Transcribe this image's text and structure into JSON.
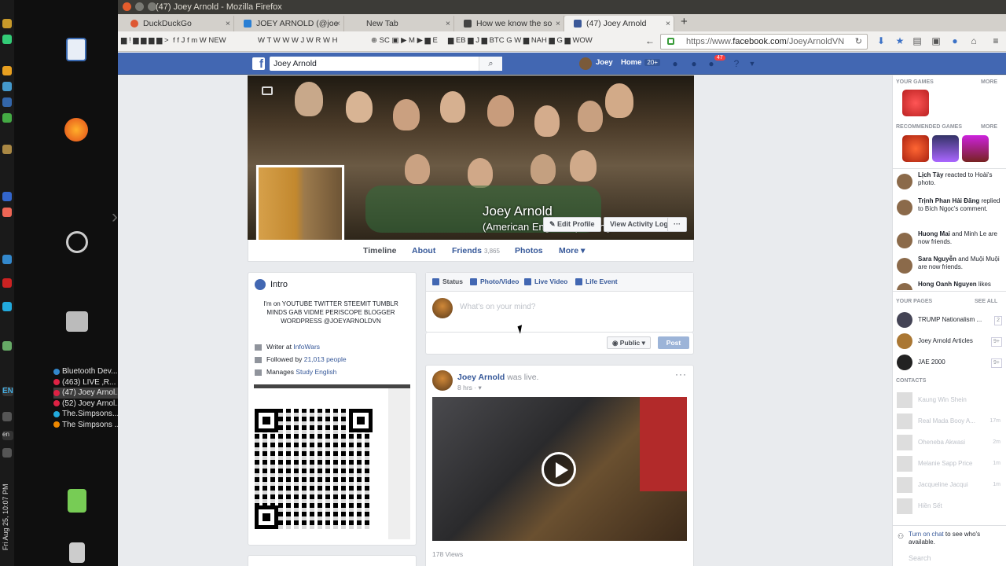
{
  "window": {
    "title": "(47) Joey Arnold - Mozilla Firefox"
  },
  "tabs": [
    {
      "label": "DuckDuckGo",
      "color": "#de5833"
    },
    {
      "label": "JOEY ARNOLD (@joe",
      "color": "#2a7fd4"
    },
    {
      "label": "New Tab",
      "color": "#dddddd"
    },
    {
      "label": "How we know the so",
      "color": "#444444"
    },
    {
      "label": "(47) Joey Arnold",
      "color": "#3b5998"
    }
  ],
  "bookmarks": [
    "!",
    "J",
    "m",
    "NEW",
    "T",
    "W",
    "J",
    "R",
    "H",
    "SC",
    "M",
    "E",
    "EB",
    "J",
    "BTC",
    "G",
    "NAH",
    "G",
    "WOW"
  ],
  "url": {
    "prefix": "https://www.",
    "domain": "facebook.com",
    "path": "/JoeyArnoldVN"
  },
  "taskbar": {
    "entries": [
      "Bluetooth Dev...",
      "(463) LIVE ‚R...",
      "(47) Joey Arnol...",
      "(52) Joey Arnol...",
      "The.Simpsons....",
      "The Simpsons ..."
    ],
    "clock": "Fri Aug 25, 10:07 PM",
    "lang": "EN",
    "lang2": "en"
  },
  "fb": {
    "search_value": "Joey Arnold",
    "user_name": "Joey",
    "home_label": "Home",
    "home_badge": "20+",
    "notif_count": "47"
  },
  "profile": {
    "name": "Joey Arnold",
    "subtitle": "(American English Speaking ...",
    "edit_profile": "Edit Profile",
    "view_activity": "View Activity Log",
    "more_dots": "···",
    "tabs": {
      "timeline": "Timeline",
      "about": "About",
      "friends": "Friends",
      "friends_count": "3,865",
      "photos": "Photos",
      "more": "More ▾"
    }
  },
  "intro": {
    "heading": "Intro",
    "bio": "I'm on YOUTUBE TWITTER STEEMIT TUMBLR MINDS GAB VIDME PERISCOPE BLOGGER WORDPRESS @JOEYARNOLDVN",
    "writer_prefix": "Writer at ",
    "writer_link": "InfoWars",
    "followed_prefix": "Followed by ",
    "followed_link": "21,013 people",
    "manages_prefix": "Manages ",
    "manages_link": "Study English"
  },
  "composer": {
    "status": "Status",
    "photo_video": "Photo/Video",
    "live_video": "Live Video",
    "life_event": "Life Event",
    "placeholder": "What's on your mind?",
    "audience": "Public ▾",
    "post": "Post"
  },
  "post": {
    "author": "Joey Arnold",
    "action": " was live.",
    "time": "8 hrs · ▾",
    "views": "178 Views"
  },
  "right": {
    "your_games": "YOUR GAMES",
    "more": "MORE",
    "recommended_games": "RECOMMENDED GAMES",
    "ticker": [
      {
        "name": "Lịch Tày",
        "text": " reacted to Hoài's photo."
      },
      {
        "name": "Trịnh Phan Hải Đăng",
        "text": " replied to Bích Ngọc's comment."
      },
      {
        "name": "Huong Mai",
        "text": " and Minh Le are now friends."
      },
      {
        "name": "Sara Nguyễn",
        "text": " and Muội Muội are now friends."
      },
      {
        "name": "Hong Oanh Nguyen",
        "text": " likes"
      }
    ],
    "your_pages": "YOUR PAGES",
    "see_all": "SEE ALL",
    "pages": [
      {
        "name": "TRUMP Nationalism ...",
        "count": "2"
      },
      {
        "name": "Joey Arnold Articles",
        "count": "9+"
      },
      {
        "name": "JAE 2000",
        "count": "9+"
      }
    ],
    "contacts_label": "CONTACTS",
    "contacts": [
      {
        "name": "Kaung Win Shein",
        "time": ""
      },
      {
        "name": "Real Mada Booy A...",
        "time": "17m"
      },
      {
        "name": "Oheneba Akwasi",
        "time": "2m"
      },
      {
        "name": "Melanie Sapp Price",
        "time": "1m"
      },
      {
        "name": "Jacqueline Jacqui",
        "time": "1m"
      },
      {
        "name": "Hiền Sết",
        "time": ""
      }
    ],
    "chat_link": "Turn on chat",
    "chat_text": " to see who's available.",
    "chat_search": "Search"
  }
}
